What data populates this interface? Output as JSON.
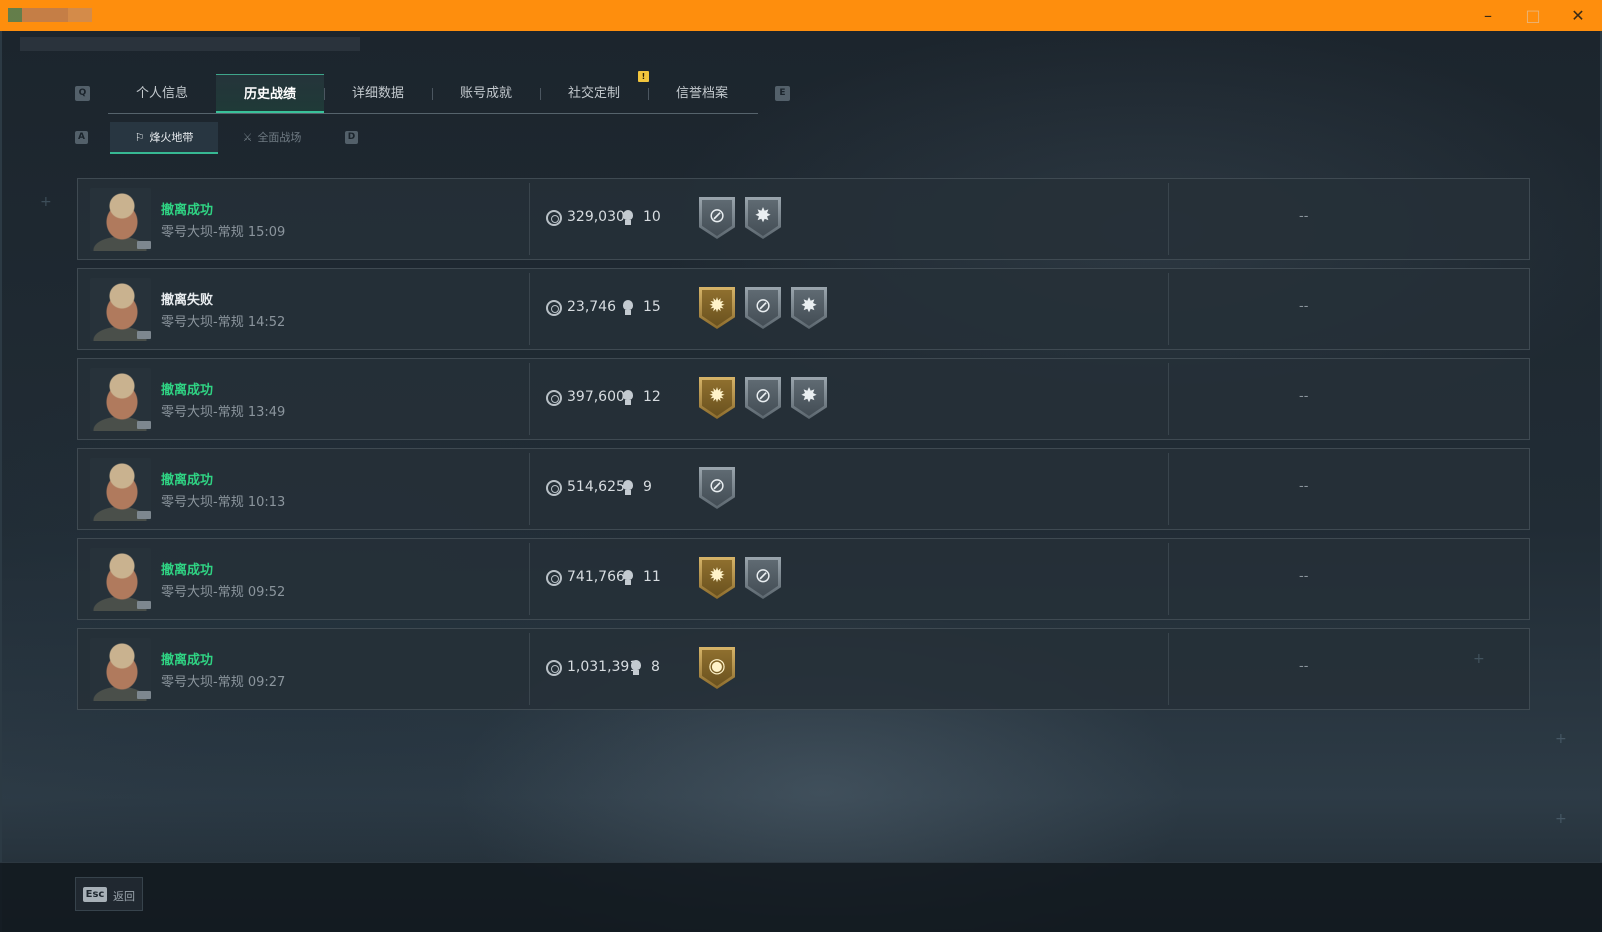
{
  "window": {
    "minimize": "–",
    "maximize": "□",
    "close": "✕"
  },
  "tabs": {
    "prev_key": "Q",
    "next_key": "E",
    "items": [
      {
        "label": "个人信息",
        "active": false
      },
      {
        "label": "历史战绩",
        "active": true
      },
      {
        "label": "详细数据",
        "active": false
      },
      {
        "label": "账号成就",
        "active": false
      },
      {
        "label": "社交定制",
        "active": false
      },
      {
        "label": "信誉档案",
        "active": false
      }
    ],
    "notice_badge": "!"
  },
  "subtabs": {
    "prev_key": "A",
    "next_key": "D",
    "items": [
      {
        "label": "烽火地带",
        "icon": "radar-icon",
        "active": true
      },
      {
        "label": "全面战场",
        "icon": "battlefield-icon",
        "active": false
      }
    ]
  },
  "matches": [
    {
      "status": "撤离成功",
      "success": true,
      "map": "零号大坝-常规 15:09",
      "value": "329,030",
      "kills": "10",
      "badges": [
        "silver-crosshair",
        "silver-burst"
      ],
      "extra": "--"
    },
    {
      "status": "撤离失败",
      "success": false,
      "map": "零号大坝-常规 14:52",
      "value": "23,746",
      "kills": "15",
      "badges": [
        "gold-sun",
        "silver-crosshair",
        "silver-burst"
      ],
      "extra": "--"
    },
    {
      "status": "撤离成功",
      "success": true,
      "map": "零号大坝-常规 13:49",
      "value": "397,600",
      "kills": "12",
      "badges": [
        "gold-sun",
        "silver-crosshair",
        "silver-burst"
      ],
      "extra": "--"
    },
    {
      "status": "撤离成功",
      "success": true,
      "map": "零号大坝-常规 10:13",
      "value": "514,625",
      "kills": "9",
      "badges": [
        "silver-crosshair"
      ],
      "extra": "--"
    },
    {
      "status": "撤离成功",
      "success": true,
      "map": "零号大坝-常规 09:52",
      "value": "741,766",
      "kills": "11",
      "badges": [
        "gold-sun",
        "silver-crosshair"
      ],
      "extra": "--"
    },
    {
      "status": "撤离成功",
      "success": true,
      "map": "零号大坝-常规 09:27",
      "value": "1,031,391",
      "kills": "8",
      "badges": [
        "gold-coin"
      ],
      "extra": "--"
    }
  ],
  "footer": {
    "esc_key": "Esc",
    "back_label": "返回"
  },
  "colors": {
    "titlebar": "#fe8e0d",
    "success": "#2fd383",
    "accent": "#39c29a"
  }
}
